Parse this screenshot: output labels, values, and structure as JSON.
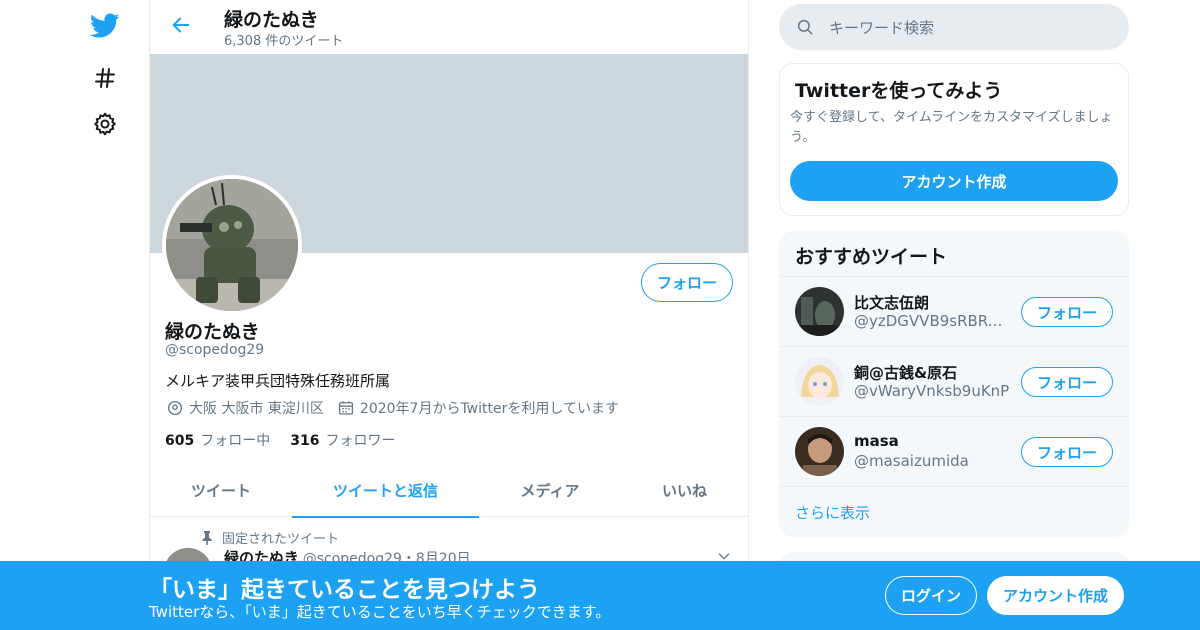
{
  "colors": {
    "accent": "#1da1f2",
    "banner": "#ccd6dd",
    "text": "#14171a",
    "muted": "#657786",
    "border": "#e6ecf0"
  },
  "nav": {
    "items": [
      {
        "icon": "twitter-bird-icon"
      },
      {
        "icon": "hashtag-icon"
      },
      {
        "icon": "gear-icon"
      }
    ]
  },
  "header": {
    "name": "緑のたぬき",
    "tweet_count": "6,308 件のツイート"
  },
  "profile": {
    "follow_label": "フォロー",
    "name": "緑のたぬき",
    "handle": "@scopedog29",
    "bio": "メルキア装甲兵団特殊任務班所属",
    "location": "大阪 大阪市 東淀川区",
    "joined": "2020年7月からTwitterを利用しています",
    "following_count": "605",
    "following_label": "フォロー中",
    "followers_count": "316",
    "followers_label": "フォロワー"
  },
  "tabs": [
    {
      "label": "ツイート"
    },
    {
      "label": "ツイートと返信"
    },
    {
      "label": "メディア"
    },
    {
      "label": "いいね"
    }
  ],
  "pinned_tweet": {
    "pinned_label": "固定されたツイート",
    "name": "緑のたぬき",
    "meta": "@scopedog29・8月20日"
  },
  "search": {
    "placeholder": "キーワード検索"
  },
  "signup_card": {
    "title": "Twitterを使ってみよう",
    "description": "今すぐ登録して、タイムラインをカスタマイズしましょう。",
    "button": "アカウント作成"
  },
  "recommended": {
    "title": "おすすめツイート",
    "items": [
      {
        "name": "比文志伍朗",
        "handle": "@yzDGVVB9sRBRC...",
        "button": "フォロー"
      },
      {
        "name": "銅@古銭&原石",
        "handle": "@vWaryVnksb9uKnP",
        "button": "フォロー"
      },
      {
        "name": "masa",
        "handle": "@masaizumida",
        "button": "フォロー"
      }
    ],
    "more": "さらに表示"
  },
  "bottom_bar": {
    "title": "「いま」起きていることを見つけよう",
    "subtitle": "Twitterなら、「いま」起きていることをいち早くチェックできます。",
    "login": "ログイン",
    "signup": "アカウント作成"
  }
}
